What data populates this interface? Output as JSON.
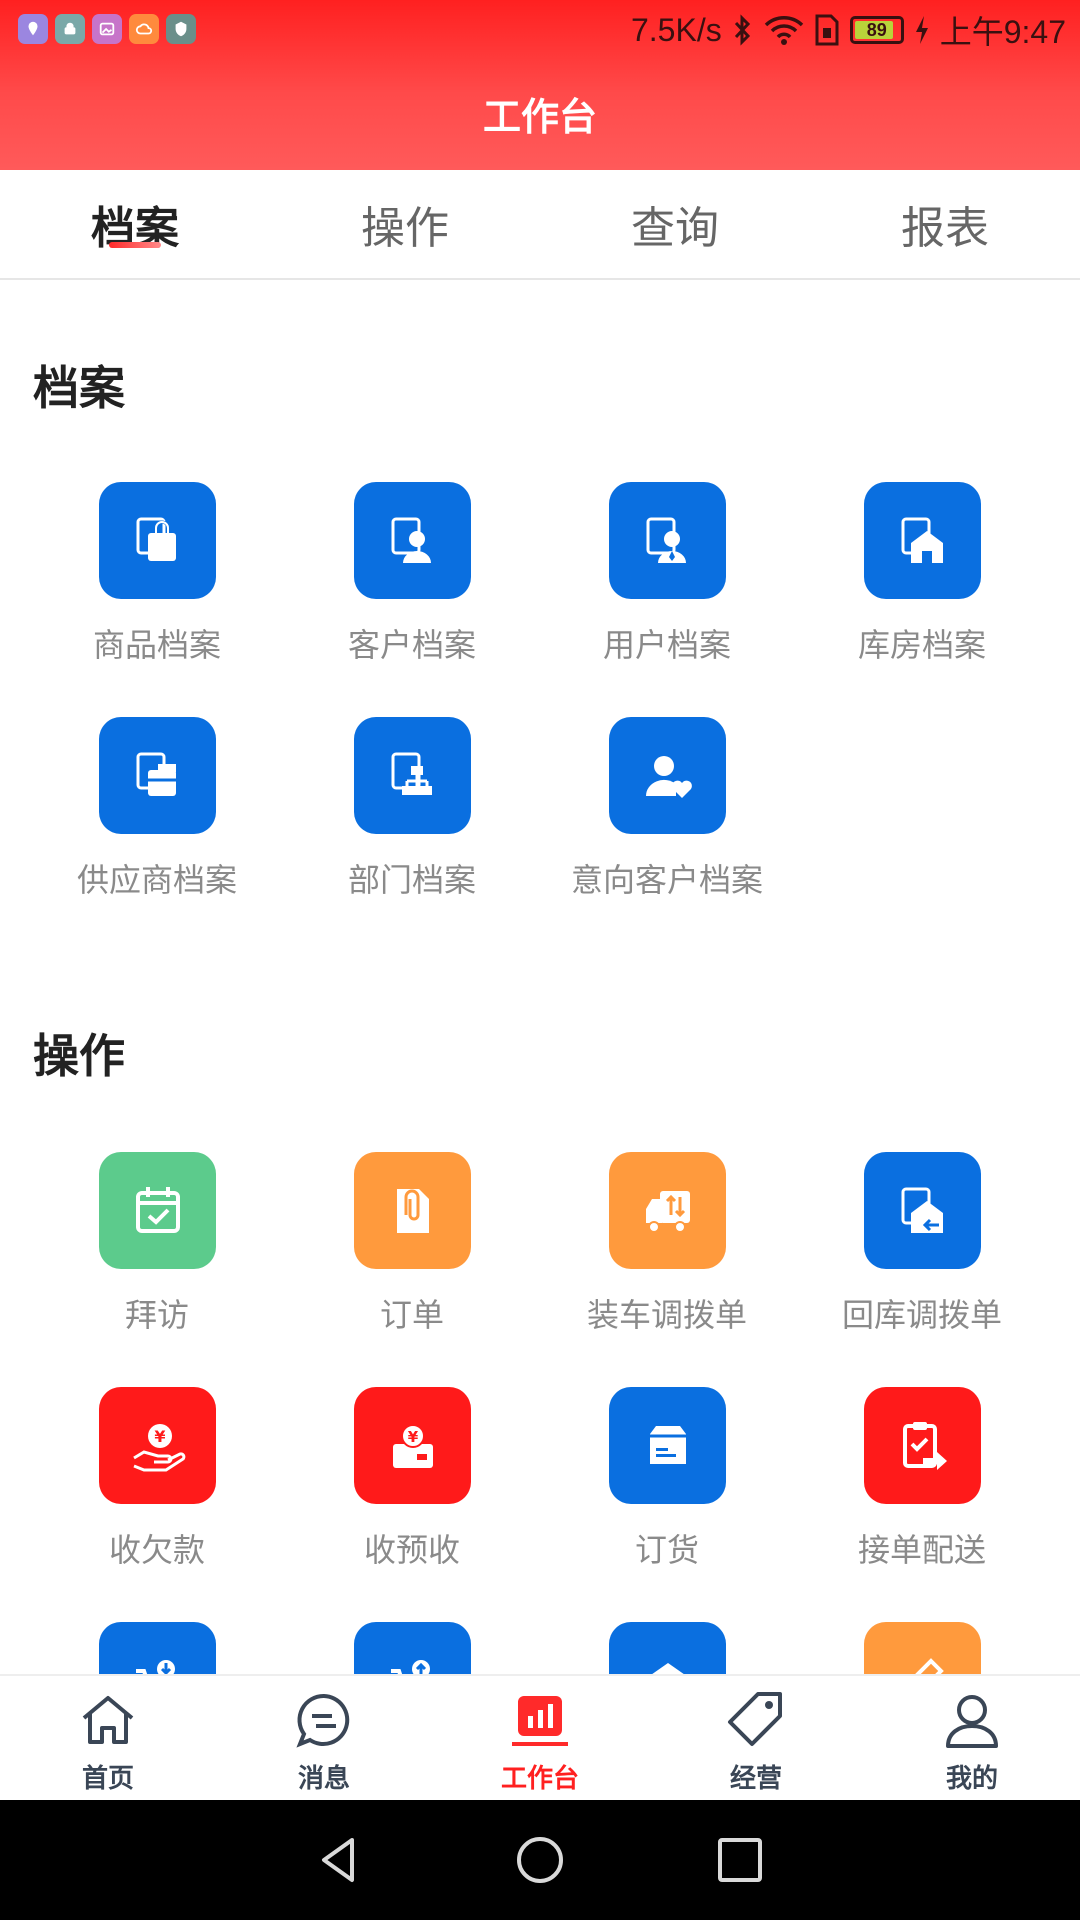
{
  "status_bar": {
    "network_speed": "7.5K/s",
    "battery_level": "89",
    "time": "上午9:47"
  },
  "header": {
    "title": "工作台"
  },
  "tabs": [
    {
      "label": "档案",
      "active": true
    },
    {
      "label": "操作",
      "active": false
    },
    {
      "label": "查询",
      "active": false
    },
    {
      "label": "报表",
      "active": false
    }
  ],
  "sections": {
    "archives": {
      "title": "档案",
      "items": [
        {
          "label": "商品档案",
          "icon": "product-archive-icon",
          "color": "#0a6fe0"
        },
        {
          "label": "客户档案",
          "icon": "customer-archive-icon",
          "color": "#0a6fe0"
        },
        {
          "label": "用户档案",
          "icon": "user-archive-icon",
          "color": "#0a6fe0"
        },
        {
          "label": "库房档案",
          "icon": "warehouse-archive-icon",
          "color": "#0a6fe0"
        },
        {
          "label": "供应商档案",
          "icon": "supplier-archive-icon",
          "color": "#0a6fe0"
        },
        {
          "label": "部门档案",
          "icon": "department-archive-icon",
          "color": "#0a6fe0"
        },
        {
          "label": "意向客户档案",
          "icon": "prospect-customer-icon",
          "color": "#0a6fe0"
        }
      ]
    },
    "operations": {
      "title": "操作",
      "items": [
        {
          "label": "拜访",
          "icon": "visit-calendar-icon",
          "color": "#5ccb8c"
        },
        {
          "label": "订单",
          "icon": "order-clip-icon",
          "color": "#ff9a3d"
        },
        {
          "label": "装车调拨单",
          "icon": "truck-transfer-icon",
          "color": "#ff9a3d"
        },
        {
          "label": "回库调拨单",
          "icon": "return-transfer-icon",
          "color": "#0a6fe0"
        },
        {
          "label": "收欠款",
          "icon": "collect-debt-icon",
          "color": "#ff1a1a"
        },
        {
          "label": "收预收",
          "icon": "collect-prepay-icon",
          "color": "#ff1a1a"
        },
        {
          "label": "订货",
          "icon": "goods-box-icon",
          "color": "#0a6fe0"
        },
        {
          "label": "接单配送",
          "icon": "delivery-clipboard-icon",
          "color": "#ff1a1a"
        }
      ],
      "partial_row_colors": [
        "#0a6fe0",
        "#0a6fe0",
        "#0a6fe0",
        "#ff9a3d"
      ]
    }
  },
  "bottom_nav": [
    {
      "label": "首页",
      "icon": "home-icon",
      "active": false
    },
    {
      "label": "消息",
      "icon": "message-icon",
      "active": false
    },
    {
      "label": "工作台",
      "icon": "workbench-chart-icon",
      "active": true
    },
    {
      "label": "经营",
      "icon": "tag-icon",
      "active": false
    },
    {
      "label": "我的",
      "icon": "profile-icon",
      "active": false
    }
  ]
}
